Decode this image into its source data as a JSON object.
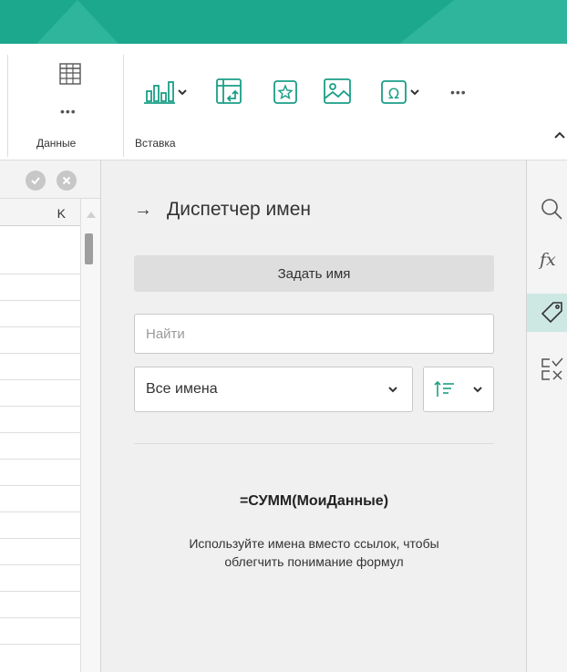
{
  "ribbon": {
    "groups": [
      {
        "label": "Данные"
      },
      {
        "label": "Вставка"
      }
    ],
    "more_glyph": "•••"
  },
  "spreadsheet": {
    "column_header": "K"
  },
  "name_manager": {
    "title": "Диспетчер имен",
    "define_button": "Задать имя",
    "search_placeholder": "Найти",
    "filter_selected": "Все имена",
    "hint_title": "=СУММ(МоиДанные)",
    "hint_line1": "Используйте имена вместо ссылок, чтобы",
    "hint_line2": "облегчить понимание формул"
  },
  "theme": {
    "accent": "#1ba88d",
    "icon_teal": "#1a9e86",
    "panel_bg": "#f0f0f0",
    "active_rail_bg": "#cde8e2"
  },
  "icons": [
    "table-icon",
    "chart-icon",
    "pivot-table-icon",
    "star-icon",
    "image-icon",
    "symbol-icon",
    "search-icon",
    "function-icon",
    "tag-icon",
    "formula-check-icon",
    "check-icon",
    "cancel-icon",
    "arrow-right-icon"
  ]
}
